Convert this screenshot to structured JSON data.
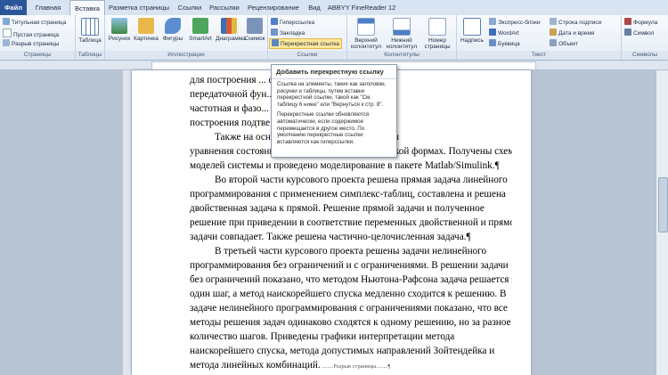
{
  "tabs": [
    "Файл",
    "Главная",
    "Вставка",
    "Разметка страницы",
    "Ссылки",
    "Рассылки",
    "Рецензирование",
    "Вид",
    "ABBYY FineReader 12"
  ],
  "ribbon": {
    "pages": {
      "items": [
        "Титульная страница",
        "Пустая страница",
        "Разрыв страницы"
      ],
      "label": "Страницы"
    },
    "table": {
      "btn": "Таблица",
      "label": "Таблицы"
    },
    "illus": {
      "btns": [
        "Рисунок",
        "Картинка",
        "Фигуры",
        "SmartArt",
        "Диаграмма",
        "Снимок"
      ],
      "label": "Иллюстрации"
    },
    "links": {
      "items": [
        "Гиперссылка",
        "Закладка",
        "Перекрестная ссылка"
      ],
      "label": "Ссылки"
    },
    "hf": {
      "btns": [
        "Верхний колонтитул",
        "Нижний колонтитул",
        "Номер страницы"
      ],
      "label": "Колонтитулы"
    },
    "text": {
      "btn": "Надпись",
      "items": [
        "Экспресс-блоки",
        "WordArt",
        "Буквица"
      ],
      "items2": [
        "Строка подписи",
        "Дата и время",
        "Объект"
      ],
      "label": "Текст"
    },
    "sym": {
      "items": [
        "Формула",
        "Символ"
      ],
      "label": "Символы"
    }
  },
  "tooltip": {
    "title": "Добавить перекрестную ссылку",
    "p1": [
      "Ссылка на элементы, такие как заголовки,",
      "рисунки и таблицы, путем вставки",
      "перекрестной ссылки, такой как \"См.",
      "таблицу 6 ниже\" или \"Вернуться к стр. 8\"."
    ],
    "p2": [
      "Перекрестные ссылки обновляются",
      "автоматически, если содержимое",
      "перемещается в другое место. По",
      "умолчанию перекрестные ссылки",
      "вставляются как гиперссылки."
    ]
  },
  "document": {
    "lines": [
      "для построения ... системы. По заданной",
      "передаточной фун... рафические амплитудно-",
      "частотная и фазо... вильность результатов",
      "построения подтве... е Matlab/Simulink.¶",
      "Также на осно... функции были составлены",
      "уравнения состояния в нормальной и канонической формах. Получены схемы",
      "моделей системы и проведено моделирование в пакете Matlab/Simulink.¶",
      "Во второй части курсового проекта решена прямая задача линейного",
      "программирования с применением симплекс-таблиц, составлена и решена",
      "двойственная задача к прямой. Решение прямой задачи и полученное",
      "решение при приведении в соответствие переменных двойственной и прямой",
      "задачи совпадает. Также решена частично-целочисленная задача.¶",
      "В третьей части курсового проекта решены задачи нелинейного",
      "программирования без ограничений и с ограничениями. В решении задачи",
      "без ограничений показано, что методом Ньютона-Рафсона задача решается за",
      "один шаг, а метод наискорейшего спуска медленно сходится к решению. В",
      "задаче нелинейного программирования с ограничениями показано, что все",
      "методы решения задач одинаково сходятся к одному решению, но за разное",
      "количество шагов. Приведены графики интерпретации метода",
      "наискорейшего спуска, метода допустимых направлений Зойтендейка и",
      "метода линейных комбинаций."
    ],
    "page_break": "Разрыв страницы"
  }
}
